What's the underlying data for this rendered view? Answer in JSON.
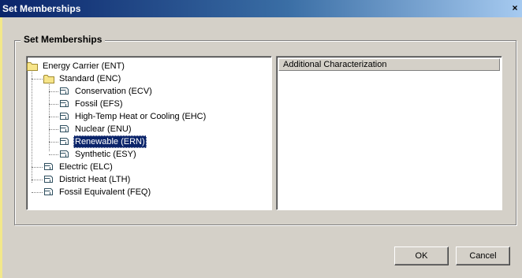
{
  "window": {
    "title": "Set Memberships",
    "close_glyph": "×"
  },
  "group": {
    "title": "Set Memberships"
  },
  "tree": {
    "root": {
      "label": "Energy Carrier (ENT)",
      "icon": "folder-icon"
    },
    "standard": {
      "label": "Standard (ENC)",
      "icon": "folder-icon"
    },
    "standard_children": [
      {
        "label": "Conservation (ECV)",
        "icon": "set-icon"
      },
      {
        "label": "Fossil (EFS)",
        "icon": "set-icon"
      },
      {
        "label": "High-Temp Heat or Cooling (EHC)",
        "icon": "set-icon"
      },
      {
        "label": "Nuclear (ENU)",
        "icon": "set-icon"
      },
      {
        "label": "Renewable (ERN)",
        "icon": "set-icon",
        "selected": true
      },
      {
        "label": "Synthetic (ESY)",
        "icon": "set-icon"
      }
    ],
    "root_children": [
      {
        "label": "Electric (ELC)",
        "icon": "set-icon"
      },
      {
        "label": "District Heat (LTH)",
        "icon": "set-icon"
      },
      {
        "label": "Fossil Equivalent (FEQ)",
        "icon": "set-icon"
      }
    ]
  },
  "list": {
    "column_header": "Additional Characterization"
  },
  "buttons": {
    "ok": "OK",
    "cancel": "Cancel"
  },
  "colors": {
    "dialog_bg": "#d4d0c8",
    "titlebar_start": "#0a246a",
    "selection": "#0a246a",
    "folder": "#f7e58a"
  }
}
